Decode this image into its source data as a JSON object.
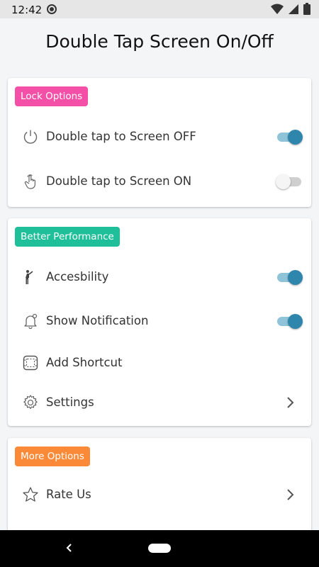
{
  "status_bar": {
    "time": "12:42"
  },
  "header": {
    "title": "Double Tap Screen On/Off"
  },
  "sections": {
    "lock": {
      "badge": "Lock Options",
      "badge_color": "#f550a8",
      "items": [
        {
          "label": "Double tap to Screen OFF",
          "icon": "power-icon",
          "toggle": true
        },
        {
          "label": "Double tap to Screen ON",
          "icon": "tap-hand-icon",
          "toggle": false
        }
      ]
    },
    "performance": {
      "badge": "Better Performance",
      "badge_color": "#1fbf9a",
      "items": [
        {
          "label": "Accesbility",
          "icon": "accessibility-person-icon",
          "toggle": true
        },
        {
          "label": "Show Notification",
          "icon": "bell-icon",
          "toggle": true
        },
        {
          "label": "Add Shortcut",
          "icon": "shortcut-icon"
        },
        {
          "label": "Settings",
          "icon": "gear-icon"
        }
      ]
    },
    "more": {
      "badge": "More Options",
      "badge_color": "#fb8a38",
      "items": [
        {
          "label": "Rate Us",
          "icon": "star-icon"
        }
      ]
    }
  },
  "colors": {
    "accent": "#2f86ad",
    "track_on": "#8ec3d8"
  }
}
